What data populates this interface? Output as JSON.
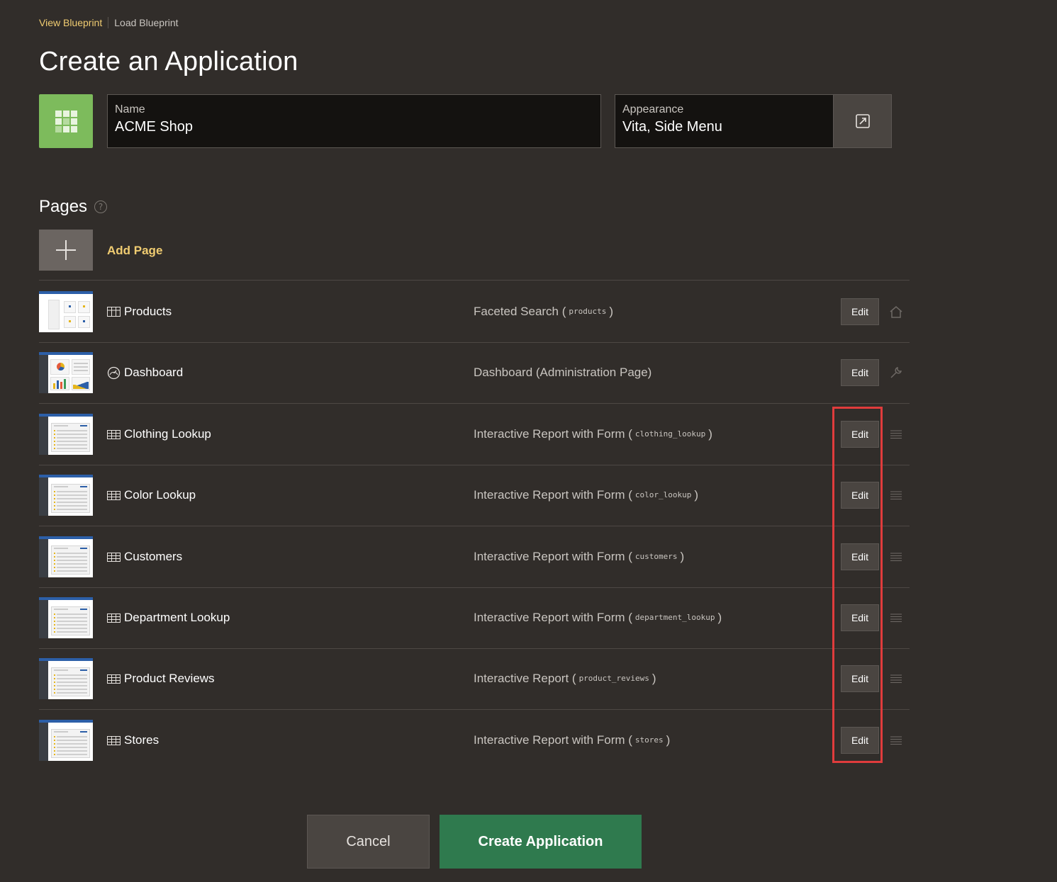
{
  "breadcrumb": {
    "view_blueprint": "View Blueprint",
    "load_blueprint": "Load Blueprint"
  },
  "page_title": "Create an Application",
  "name_field": {
    "label": "Name",
    "value": "ACME Shop"
  },
  "appearance_field": {
    "label": "Appearance",
    "value": "Vita, Side Menu"
  },
  "pages_section": {
    "title": "Pages",
    "help": "?",
    "add_page_label": "Add Page"
  },
  "pages": [
    {
      "title": "Products",
      "type_prefix": "Faceted Search (",
      "table": "products",
      "type_suffix": ")",
      "edit_label": "Edit",
      "title_icon": "faceted-search-icon",
      "row_icon": "home-icon"
    },
    {
      "title": "Dashboard",
      "type_prefix": "Dashboard (Administration Page)",
      "table": "",
      "type_suffix": "",
      "edit_label": "Edit",
      "title_icon": "gauge-icon",
      "row_icon": "wrench-icon"
    },
    {
      "title": "Clothing Lookup",
      "type_prefix": "Interactive Report with Form (",
      "table": "clothing_lookup",
      "type_suffix": ")",
      "edit_label": "Edit",
      "title_icon": "table-icon",
      "row_icon": "drag-handle-icon"
    },
    {
      "title": "Color Lookup",
      "type_prefix": "Interactive Report with Form (",
      "table": "color_lookup",
      "type_suffix": ")",
      "edit_label": "Edit",
      "title_icon": "table-icon",
      "row_icon": "drag-handle-icon"
    },
    {
      "title": "Customers",
      "type_prefix": "Interactive Report with Form (",
      "table": "customers",
      "type_suffix": ")",
      "edit_label": "Edit",
      "title_icon": "table-icon",
      "row_icon": "drag-handle-icon"
    },
    {
      "title": "Department Lookup",
      "type_prefix": "Interactive Report with Form (",
      "table": "department_lookup",
      "type_suffix": ")",
      "edit_label": "Edit",
      "title_icon": "table-icon",
      "row_icon": "drag-handle-icon"
    },
    {
      "title": "Product Reviews",
      "type_prefix": "Interactive Report (",
      "table": "product_reviews",
      "type_suffix": ")",
      "edit_label": "Edit",
      "title_icon": "table-icon",
      "row_icon": "drag-handle-icon"
    },
    {
      "title": "Stores",
      "type_prefix": "Interactive Report with Form (",
      "table": "stores",
      "type_suffix": ")",
      "edit_label": "Edit",
      "title_icon": "table-icon",
      "row_icon": "drag-handle-icon"
    }
  ],
  "buttons": {
    "cancel": "Cancel",
    "create": "Create Application"
  },
  "colors": {
    "background": "#312d2a",
    "accent": "#f0cc71",
    "primary": "#2f7a4e",
    "app_icon": "#7dbb5c",
    "highlight": "#e03c3c"
  }
}
